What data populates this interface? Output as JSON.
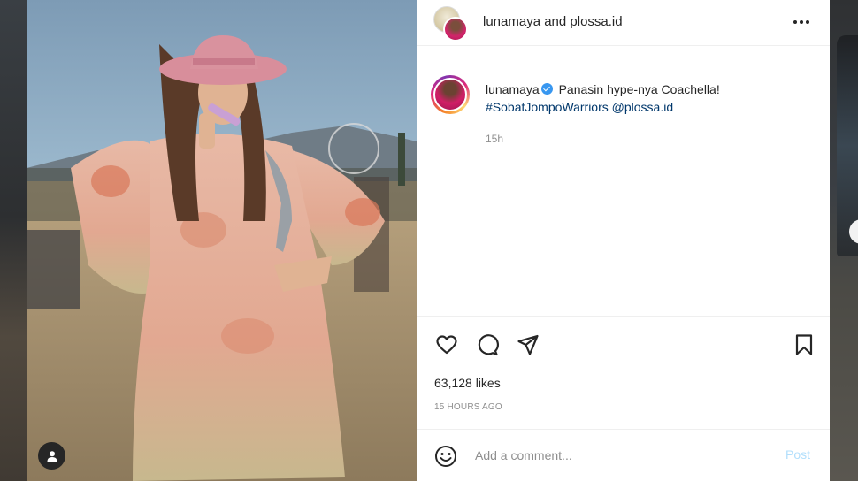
{
  "post": {
    "header_title": "lunamaya and plossa.id",
    "more_icon": "more-horizontal-icon",
    "caption": {
      "username": "lunamaya",
      "text": "Panasin hype-nya Coachella!",
      "hashtag": "#SobatJompoWarriors",
      "mention": "@plossa.id",
      "time": "15h"
    },
    "likes": "63,128 likes",
    "posted_ago": "15 HOURS AGO",
    "comment_placeholder": "Add a comment...",
    "post_button": "Post",
    "icons": {
      "like": "heart-icon",
      "comment": "comment-icon",
      "share": "paper-plane-icon",
      "save": "bookmark-icon",
      "emoji": "smiley-icon",
      "user_tag": "person-icon",
      "verified": "verified-badge-icon"
    }
  },
  "colors": {
    "link": "#00376b",
    "muted": "#8e8e8e",
    "post_button_disabled": "#b2dffc",
    "verified": "#3897f0"
  }
}
